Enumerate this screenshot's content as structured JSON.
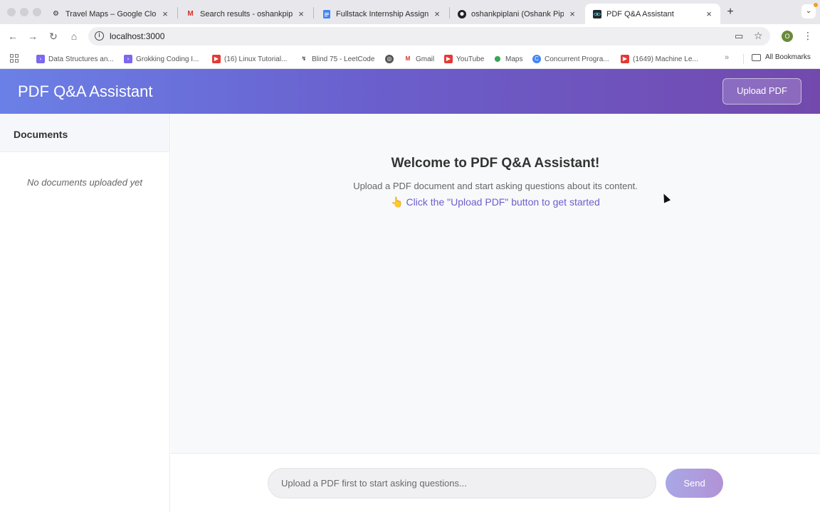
{
  "browser": {
    "tabs": [
      {
        "title": "Travel Maps – Google Cloud",
        "icon": "gear-icon",
        "active": false
      },
      {
        "title": "Search results - oshankpiplani",
        "icon": "gmail-icon",
        "active": false
      },
      {
        "title": "Fullstack Internship Assignment",
        "icon": "docs-icon",
        "active": false
      },
      {
        "title": "oshankpiplani (Oshank Piplani)",
        "icon": "github-icon",
        "active": false
      },
      {
        "title": "PDF Q&A Assistant",
        "icon": "react-icon",
        "active": true
      }
    ],
    "close_glyph": "×",
    "new_tab_glyph": "+",
    "url": "localhost:3000",
    "profile_initial": "O",
    "bookmarks": [
      {
        "label": "Data Structures an...",
        "icon": "hackerrank-icon",
        "color": "#7b68ee"
      },
      {
        "label": "Grokking Coding I...",
        "icon": "hackerrank-icon",
        "color": "#7b68ee"
      },
      {
        "label": "(16) Linux Tutorial...",
        "icon": "youtube-icon",
        "color": "#e53935"
      },
      {
        "label": "Blind 75 - LeetCode",
        "icon": "leetcode-icon",
        "color": "#444444"
      },
      {
        "label": "",
        "icon": "globe-icon",
        "color": "#555555"
      },
      {
        "label": "Gmail",
        "icon": "gmail-icon",
        "color": "#d93025"
      },
      {
        "label": "YouTube",
        "icon": "youtube-icon",
        "color": "#e53935"
      },
      {
        "label": "Maps",
        "icon": "maps-icon",
        "color": "#34a853"
      },
      {
        "label": "Concurrent Progra...",
        "icon": "c-icon",
        "color": "#4285f4"
      },
      {
        "label": "(1649) Machine Le...",
        "icon": "youtube-icon",
        "color": "#e53935"
      }
    ],
    "more_glyph": "»",
    "all_bookmarks": "All Bookmarks"
  },
  "app": {
    "title": "PDF Q&A Assistant",
    "upload_button": "Upload PDF",
    "accent_color": "#6a5fcd"
  },
  "sidebar": {
    "title": "Documents",
    "empty_text": "No documents uploaded yet"
  },
  "main": {
    "welcome_title": "Welcome to PDF Q&A Assistant!",
    "welcome_subtitle": "Upload a PDF document and start asking questions about its content.",
    "welcome_hint": "👆 Click the \"Upload PDF\" button to get started"
  },
  "chat": {
    "placeholder": "Upload a PDF first to start asking questions...",
    "send_button": "Send"
  }
}
